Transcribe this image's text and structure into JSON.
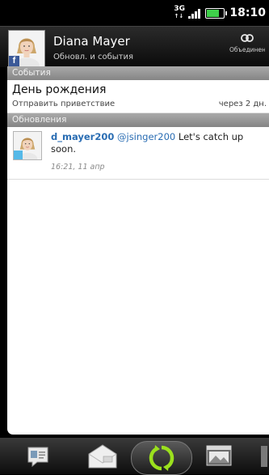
{
  "status_bar": {
    "network": "3G",
    "network_arrows": "↑↓",
    "time": "18:10",
    "battery_level": 0.75
  },
  "header": {
    "name": "Diana Mayer",
    "subtitle": "Обновл. и события",
    "link_label": "Объединенный"
  },
  "sections": {
    "events_header": "События",
    "updates_header": "Обновления"
  },
  "event": {
    "title": "День рождения",
    "action": "Отправить приветствие",
    "time": "через 2 дн."
  },
  "update": {
    "username": "d_mayer200",
    "mention": "@jsinger200",
    "message": " Let's catch up soon.",
    "timestamp": "16:21, 11 апр"
  },
  "tabs": [
    {
      "icon": "profile-card-icon"
    },
    {
      "icon": "envelope-icon"
    },
    {
      "icon": "refresh-icon"
    },
    {
      "icon": "gallery-icon"
    }
  ],
  "colors": {
    "accent_link": "#2a6db3",
    "facebook": "#3b5998",
    "twitter": "#55b9e8",
    "refresh": "#9be01d"
  }
}
